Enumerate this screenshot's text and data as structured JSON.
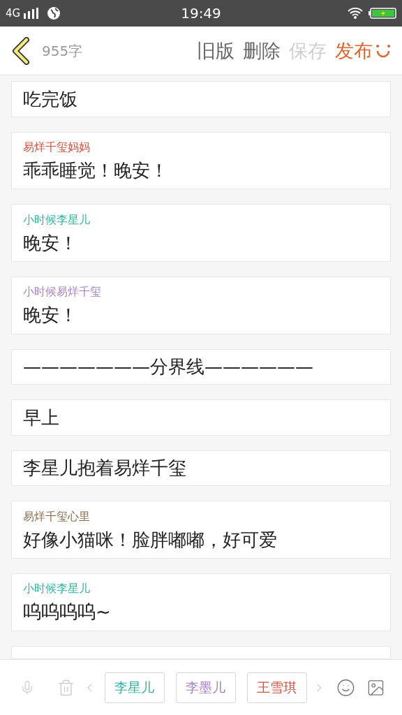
{
  "status_bar": {
    "network": "4G",
    "time": "19:49"
  },
  "header": {
    "word_count": "955字",
    "actions": [
      {
        "label": "旧版",
        "disabled": false,
        "primary": false
      },
      {
        "label": "删除",
        "disabled": false,
        "primary": false
      },
      {
        "label": "保存",
        "disabled": true,
        "primary": false
      },
      {
        "label": "发布",
        "disabled": false,
        "primary": true
      }
    ]
  },
  "blocks": [
    {
      "kind": "narration",
      "text": "吃完饭"
    },
    {
      "kind": "dialogue",
      "speaker": "易烊千玺妈妈",
      "color": "#d0503c",
      "text": "乖乖睡觉！晚安！"
    },
    {
      "kind": "dialogue",
      "speaker": "小时候李星儿",
      "color": "#2fb3a0",
      "text": "晚安！"
    },
    {
      "kind": "dialogue",
      "speaker": "小时候易烊千玺",
      "color": "#a97fc6",
      "text": "晚安！"
    },
    {
      "kind": "narration",
      "text": "———————分界线——————"
    },
    {
      "kind": "narration",
      "text": "早上"
    },
    {
      "kind": "narration",
      "text": "李星儿抱着易烊千玺"
    },
    {
      "kind": "dialogue",
      "speaker": "易烊千玺心里",
      "color": "#8a6a4a",
      "text": "好像小猫咪！脸胖嘟嘟，好可爱"
    },
    {
      "kind": "dialogue",
      "speaker": "小时候李星儿",
      "color": "#2fb3a0",
      "text": "呜呜呜呜~"
    }
  ],
  "toolbar": {
    "characters": [
      {
        "name": "李星儿",
        "color": "#2fb3a0"
      },
      {
        "name": "李墨儿",
        "color": "#a97fc6"
      },
      {
        "name": "王雪琪",
        "color": "#d0503c"
      }
    ]
  }
}
